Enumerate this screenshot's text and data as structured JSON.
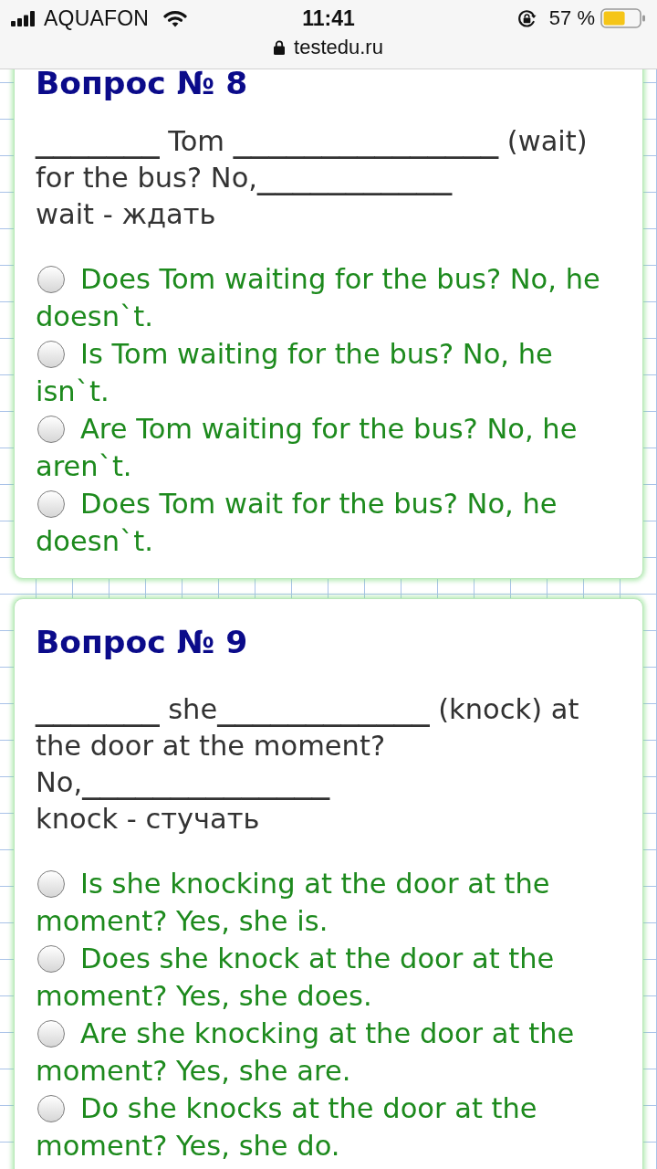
{
  "status_bar": {
    "carrier": "AQUAFON",
    "time": "11:41",
    "battery": "57 %",
    "url": "testedu.ru"
  },
  "questions": [
    {
      "title": "Вопрос № 8",
      "prompt": "_______ Tom _______________ (wait) for the bus? No,___________",
      "hint": "wait - ждать",
      "options": [
        {
          "text": "Does Tom waiting for the bus? No, he doesn`t.",
          "selected": false
        },
        {
          "text": "Is Tom waiting for the bus? No, he isn`t.",
          "selected": false
        },
        {
          "text": "Are Tom waiting for the bus? No, he aren`t.",
          "selected": false
        },
        {
          "text": "Does Tom wait for the bus? No, he doesn`t.",
          "selected": false
        }
      ]
    },
    {
      "title": "Вопрос № 9",
      "prompt": "_______ she____________ (knock) at the door at the moment? No,______________",
      "hint": "knock - стучать",
      "options": [
        {
          "text": "Is she knocking at the door at the moment? Yes, she is.",
          "selected": false
        },
        {
          "text": "Does she knock at the door at the moment? Yes, she does.",
          "selected": false
        },
        {
          "text": "Are she knocking at the door at the moment? Yes, she are.",
          "selected": false
        },
        {
          "text": "Do she knocks at the door at the moment? Yes, she do.",
          "selected": false
        }
      ]
    }
  ]
}
